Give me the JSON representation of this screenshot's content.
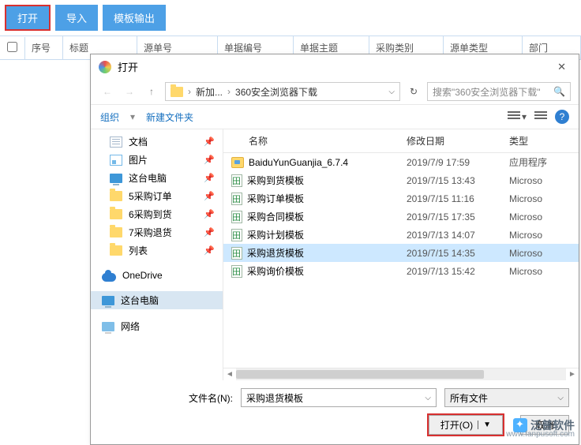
{
  "toolbar": {
    "open": "打开",
    "import": "导入",
    "template_out": "模板输出"
  },
  "grid_header": [
    "序号",
    "标题",
    "源单号",
    "单据编号",
    "单据主题",
    "采购类别",
    "源单类型",
    "部门"
  ],
  "dialog": {
    "title": "打开",
    "crumb": {
      "root": "新加...",
      "folder": "360安全浏览器下载"
    },
    "search_placeholder": "搜索\"360安全浏览器下载\"",
    "organize": "组织",
    "new_folder": "新建文件夹",
    "columns": {
      "name": "名称",
      "date": "修改日期",
      "type": "类型"
    },
    "sidebar": {
      "items": [
        {
          "label": "文档",
          "icon": "doc",
          "pinned": true
        },
        {
          "label": "图片",
          "icon": "img",
          "pinned": true
        },
        {
          "label": "这台电脑",
          "icon": "pc",
          "pinned": true
        },
        {
          "label": "5采购订单",
          "icon": "fold",
          "pinned": true
        },
        {
          "label": "6采购到货",
          "icon": "fold",
          "pinned": true
        },
        {
          "label": "7采购退货",
          "icon": "fold",
          "pinned": true
        },
        {
          "label": "列表",
          "icon": "fold",
          "pinned": true
        }
      ],
      "onedrive": "OneDrive",
      "this_pc": "这台电脑",
      "network": "网络"
    },
    "files": [
      {
        "name": "BaiduYunGuanjia_6.7.4",
        "date": "2019/7/9 17:59",
        "type": "应用程序",
        "icon": "app"
      },
      {
        "name": "采购到货模板",
        "date": "2019/7/15 13:43",
        "type": "Microso",
        "icon": "xls"
      },
      {
        "name": "采购订单模板",
        "date": "2019/7/15 11:16",
        "type": "Microso",
        "icon": "xls"
      },
      {
        "name": "采购合同模板",
        "date": "2019/7/15 17:35",
        "type": "Microso",
        "icon": "xls"
      },
      {
        "name": "采购计划模板",
        "date": "2019/7/13 14:07",
        "type": "Microso",
        "icon": "xls"
      },
      {
        "name": "采购退货模板",
        "date": "2019/7/15 14:35",
        "type": "Microso",
        "icon": "xls",
        "selected": true
      },
      {
        "name": "采购询价模板",
        "date": "2019/7/13 15:42",
        "type": "Microso",
        "icon": "xls"
      }
    ],
    "filename_label": "文件名(N):",
    "filename_value": "采购退货模板",
    "filetype_value": "所有文件",
    "open_btn": "打开(O)",
    "cancel_btn": "取消"
  },
  "watermark": {
    "brand": "泛普软件",
    "url": "www.fanpusoft.com"
  }
}
